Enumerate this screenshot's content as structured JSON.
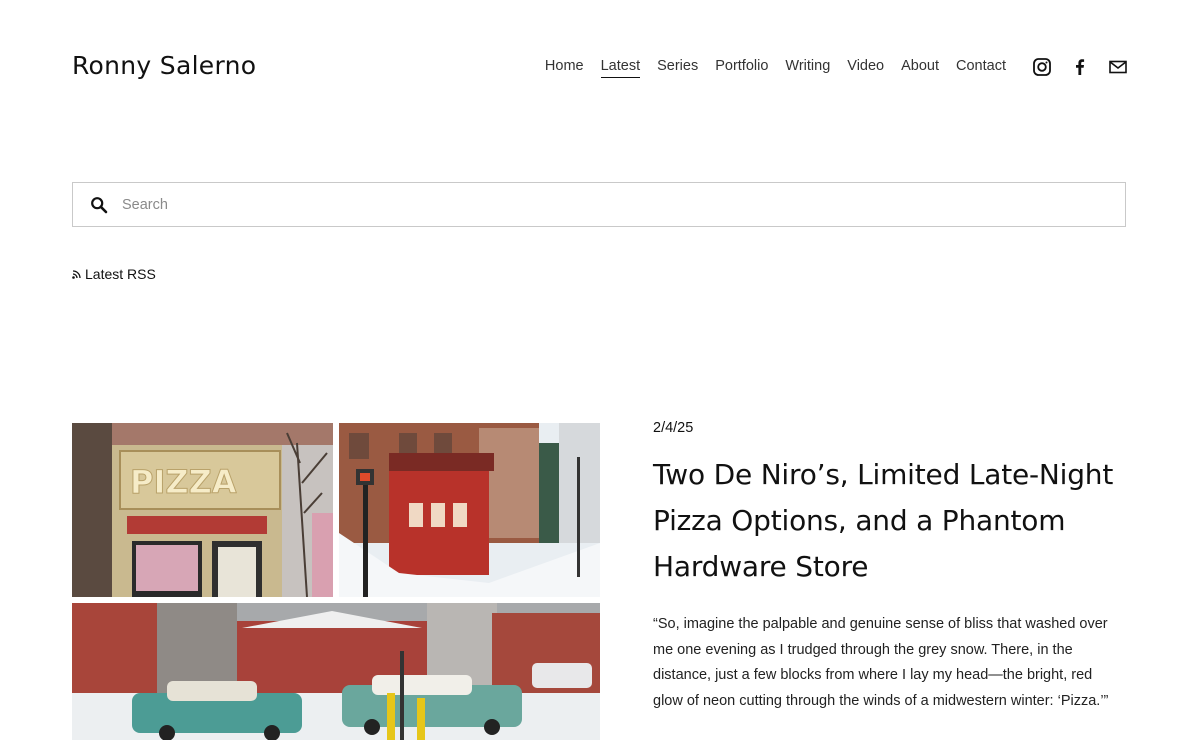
{
  "site": {
    "title": "Ronny Salerno"
  },
  "nav": {
    "items": [
      {
        "label": "Home",
        "active": false
      },
      {
        "label": "Latest",
        "active": true
      },
      {
        "label": "Series",
        "active": false
      },
      {
        "label": "Portfolio",
        "active": false
      },
      {
        "label": "Writing",
        "active": false
      },
      {
        "label": "Video",
        "active": false
      },
      {
        "label": "About",
        "active": false
      },
      {
        "label": "Contact",
        "active": false
      }
    ]
  },
  "social": {
    "icons": [
      "instagram-icon",
      "facebook-icon",
      "mail-icon"
    ]
  },
  "search": {
    "placeholder": "Search",
    "value": ""
  },
  "rss": {
    "label": "Latest RSS"
  },
  "post": {
    "date": "2/4/25",
    "title": "Two De Niro’s, Limited Late-Night Pizza Options, and a Phantom Hardware Store",
    "excerpt": "“So, imagine the palpable and genuine sense of bliss that washed over me one evening as I trudged through the grey snow. There, in the distance, just a few blocks from where I lay my head—the bright, red glow of neon cutting through the winds of a midwestern winter: ‘Pizza.’”",
    "photo_sign_text": "PIZZA"
  },
  "colors": {
    "text": "#111111",
    "border": "#c9c9c9",
    "neon": "#c0392b"
  }
}
